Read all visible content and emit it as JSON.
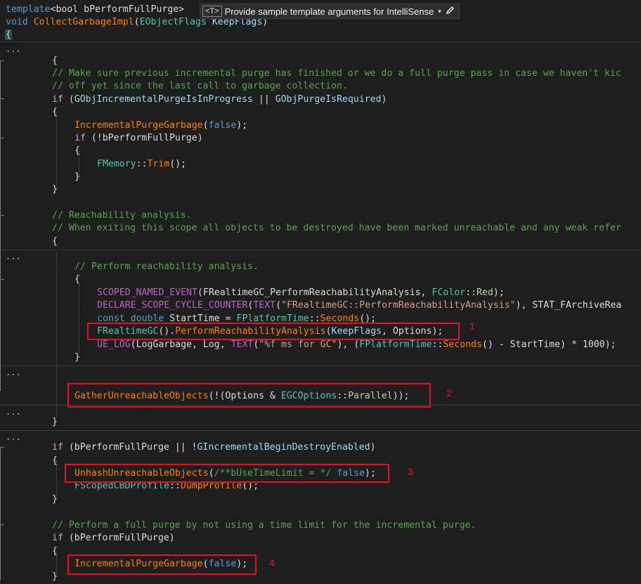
{
  "hint": {
    "badge": "<T>",
    "text": "Provide sample template arguments for IntelliSense",
    "caret": "▾",
    "edit_icon": "pencil-icon"
  },
  "fold_dots": "...",
  "markers": [
    "1",
    "2",
    "3",
    "4"
  ],
  "code": {
    "l_tpl_kw": "template",
    "l_tpl_rest": "<bool bPerformFullPurge>",
    "l_void": "void",
    "l_fnname": "CollectGarbageImpl",
    "l_sig_open": "(",
    "l_sig_type": "EObjectFlags",
    "l_sig_param": "KeepFlags",
    "l_sig_close": ")",
    "brace_open": "{",
    "brace_close": "}",
    "c1": "// Make sure previous incremental purge has finished or we do a full purge pass in case we haven't kic",
    "c2": "// off yet since the last call to garbage collection.",
    "if_kw": "if",
    "if1_open": " (",
    "if1_var1": "GObjIncrementalPurgeIsInProgress",
    "if1_or": " || ",
    "if1_var2": "GObjPurgeIsRequired",
    "close_paren": ")",
    "ipg_fn": "IncrementalPurgeGarbage",
    "open_paren": "(",
    "false_kw": "false",
    "call_end": ");",
    "if2_open": " (!",
    "if2_param": "bPerformFullPurge",
    "fmem_type": "FMemory",
    "scope": "::",
    "trim_fn": "Trim",
    "trim_end": "();",
    "c3": "// Reachability analysis.",
    "c4": "// When exiting this scope all objects to be destroyed have been marked unreachable and any weak refer",
    "c5": "// Perform reachability analysis.",
    "scoped_macro": "SCOPED_NAMED_EVENT",
    "scoped_arg1": "FRealtimeGC_PerformReachabilityAnalysis",
    "comma": ", ",
    "fcolor": "FColor",
    "red": "Red",
    "declare_macro": "DECLARE_SCOPE_CYCLE_COUNTER",
    "text_macro": "TEXT",
    "declare_str": "\"FRealtimeGC::PerformReachabilityAnalysis\"",
    "declare_rest": "), STAT_FArchiveRea",
    "const_kw": "const",
    "double_kw": "double",
    "starttime_var": " StartTime",
    "assign": " = ",
    "fplat": "FPlatformTime",
    "seconds": "Seconds",
    "frgc": "FRealtimeGC",
    "call_chain": "().",
    "pra_fn": "PerformReachabilityAnalysis",
    "keepflags": "KeepFlags",
    "options": "Options",
    "ue_log": "UE_LOG",
    "log_args_a": "(LogGarbage, ",
    "log_var": "Log",
    "log_str": "\"%f ms for GC\"",
    "log_rest_a": "), (",
    "log_minus": "() - ",
    "starttime": "StartTime",
    "log_tail": ") * 1000);",
    "guo_fn": "GatherUnreachableObjects",
    "guo_open": "(!(",
    "amp": " & ",
    "egc": "EGCOptions",
    "parallel": "Parallel",
    "guo_end": "));",
    "if3_param": "bPerformFullPurge",
    "if3_var": "GIncrementalBeginDestroyEnabled",
    "if3_or": " || !",
    "uuo_fn": "UnhashUnreachableObjects",
    "uuo_comment": "/**bUseTimeLimit = */",
    "space": " ",
    "fscoped": "FScopedCBDProfile",
    "dump_fn": "DumpProfile",
    "c6": "// Perform a full purge by not using a time limit for the incremental purge.",
    "if4_param": "bPerformFullPurge"
  }
}
